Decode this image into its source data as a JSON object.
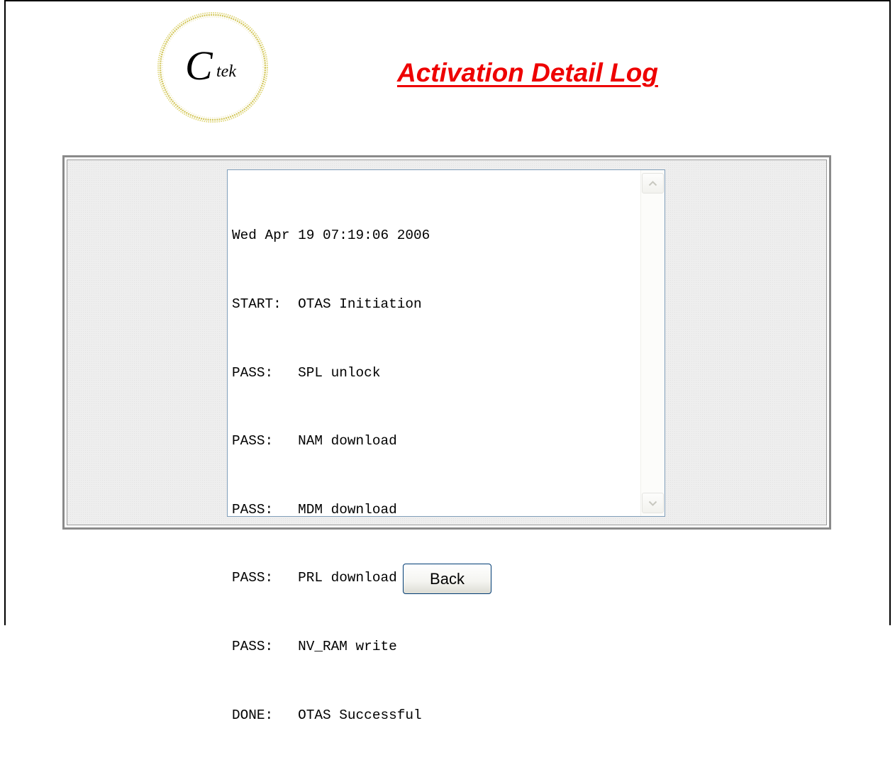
{
  "logo": {
    "text": "Ctek"
  },
  "header": {
    "title": "Activation Detail Log"
  },
  "log": {
    "lines": [
      "Wed Apr 19 07:19:06 2006",
      "START:  OTAS Initiation",
      "PASS:   SPL unlock",
      "PASS:   NAM download",
      "PASS:   MDM download",
      "PASS:   PRL download",
      "PASS:   NV_RAM write",
      "DONE:   OTAS Successful"
    ],
    "scroll_up_icon": "chevron-up-icon",
    "scroll_down_icon": "chevron-down-icon"
  },
  "footer": {
    "back_label": "Back"
  },
  "colors": {
    "title": "#ee0000",
    "logo_ring": "#d8cc6a"
  }
}
